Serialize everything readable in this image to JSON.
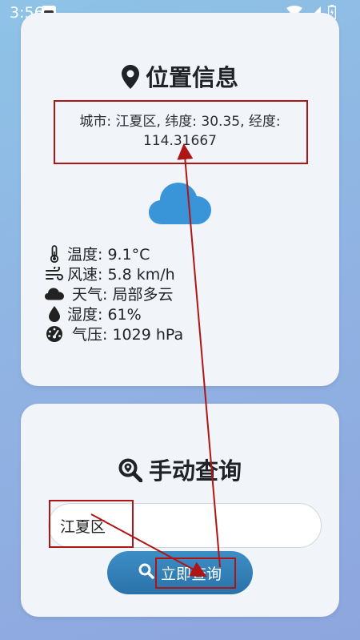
{
  "status_bar": {
    "time": "3:56",
    "icons": [
      "app-notification-icon",
      "wifi-icon",
      "signal-icon",
      "battery-icon"
    ]
  },
  "location_card": {
    "title": "位置信息",
    "title_icon": "map-pin-icon",
    "city_info": "城市: 江夏区, 纬度: 30.35, 经度: 114.31667",
    "weather_icon": "cloud-icon",
    "weather": [
      {
        "icon": "thermometer-icon",
        "text": "温度: 9.1°C"
      },
      {
        "icon": "wind-icon",
        "text": "风速: 5.8 km/h"
      },
      {
        "icon": "cloud-small-icon",
        "text": "天气: 局部多云"
      },
      {
        "icon": "droplet-icon",
        "text": "湿度: 61%"
      },
      {
        "icon": "gauge-icon",
        "text": "气压: 1029 hPa"
      }
    ]
  },
  "query_card": {
    "title": "手动查询",
    "title_icon": "search-location-icon",
    "city_input_value": "江夏区",
    "query_button_label": "立即查询",
    "query_button_icon": "search-icon"
  },
  "colors": {
    "card_bg": "#f1f4f9",
    "button_blue": "#2f7fb8",
    "cloud_blue": "#3a95d8",
    "annotation_red": "#b01515"
  }
}
